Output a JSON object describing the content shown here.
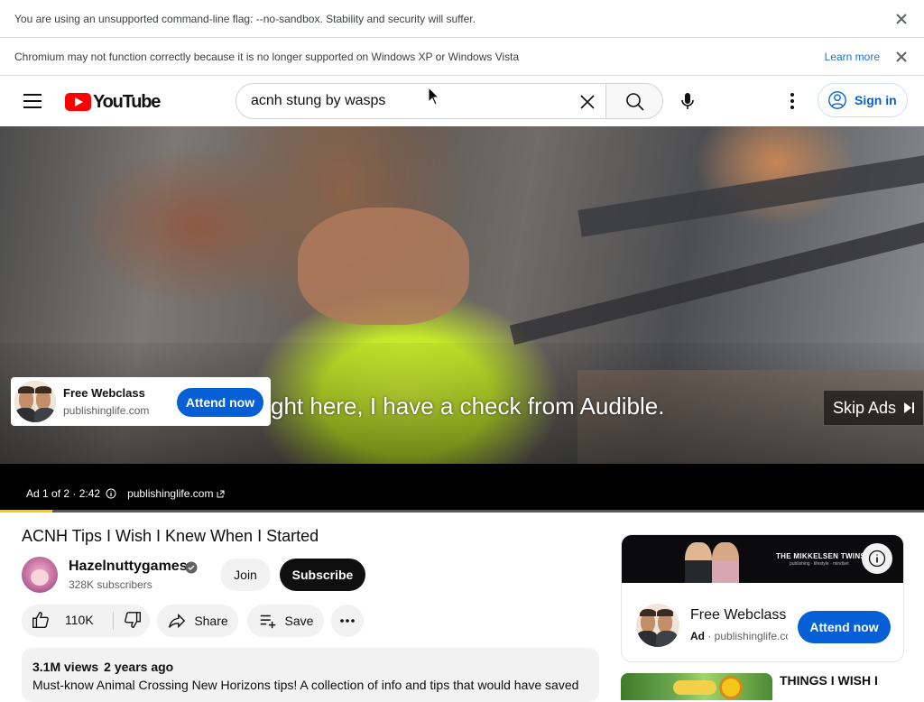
{
  "infobars": [
    {
      "text": "You are using an unsupported command-line flag: --no-sandbox. Stability and security will suffer."
    },
    {
      "text": "Chromium may not function correctly because it is no longer supported on Windows XP or Windows Vista",
      "link": "Learn more"
    }
  ],
  "masthead": {
    "logo_text": "YouTube",
    "search_value": "acnh stung by wasps",
    "signin_label": "Sign in"
  },
  "player": {
    "caption": "ght here, I have a check from Audible.",
    "ad_card": {
      "title": "Free Webclass",
      "domain": "publishinglife.com",
      "cta": "Attend now"
    },
    "skip_label": "Skip Ads",
    "ad_info": {
      "position": "Ad 1 of 2 · 2:42",
      "domain": "publishinglife.com"
    },
    "progress_fraction": 0.057
  },
  "video": {
    "title": "ACNH Tips I Wish I Knew When I Started",
    "channel": "Hazelnuttygames",
    "subscribers": "328K subscribers",
    "join_label": "Join",
    "subscribe_label": "Subscribe",
    "likes": "110K",
    "share_label": "Share",
    "save_label": "Save",
    "views": "3.1M views",
    "age": "2 years ago",
    "description": "Must-know Animal Crossing New Horizons tips! A collection of info and tips that would have saved"
  },
  "side_ad": {
    "banner_brand": "THE MIKKELSEN TWINS",
    "banner_tag": "publishing · lifestyle · mindset",
    "title": "Free Webclass",
    "ad_label": "Ad",
    "domain": "publishinglife.com",
    "cta": "Attend now"
  },
  "recommendation": {
    "title": "THINGS I WISH I"
  },
  "colors": {
    "brand_red": "#ff0000",
    "cta_blue": "#065fd4",
    "progress_yellow": "#ffcc00"
  }
}
